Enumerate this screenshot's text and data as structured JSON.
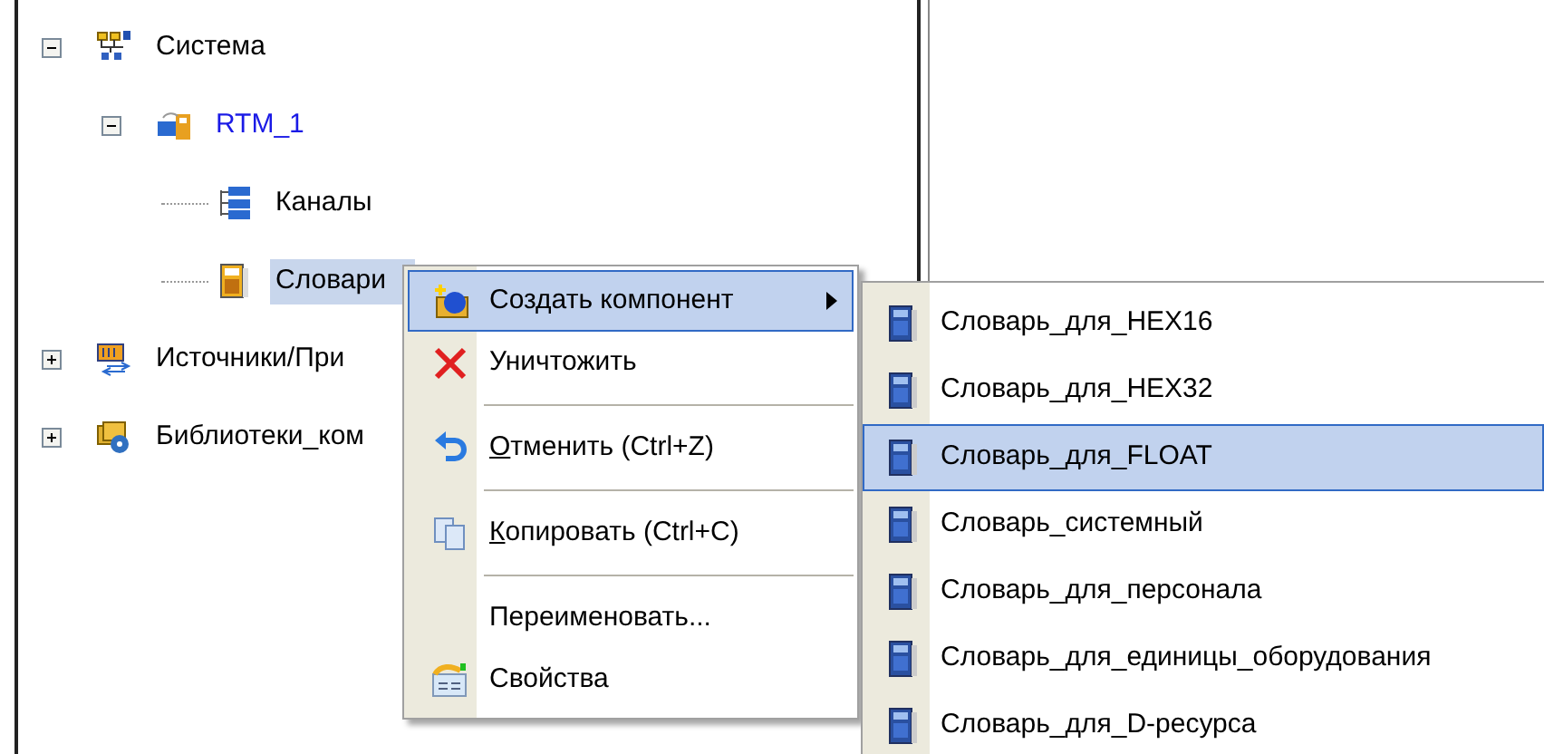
{
  "tree": [
    {
      "label": "Система",
      "expanded": true,
      "selected": false,
      "link": false,
      "children": [
        {
          "label": "RTM_1",
          "expanded": true,
          "selected": false,
          "link": true,
          "children": [
            {
              "label": "Каналы",
              "selected": false,
              "link": false
            },
            {
              "label": "Словари",
              "selected": true,
              "link": false
            }
          ]
        }
      ]
    },
    {
      "label": "Источники/При",
      "expanded": false,
      "selected": false,
      "link": false
    },
    {
      "label": "Библиотеки_ком",
      "expanded": false,
      "selected": false,
      "link": false
    }
  ],
  "context_menu": {
    "items": [
      {
        "kind": "item",
        "label": "Создать компонент",
        "submenu": true,
        "selected": true,
        "mnemonic": false
      },
      {
        "kind": "item",
        "label": "Уничтожить",
        "submenu": false,
        "selected": false,
        "mnemonic": false
      },
      {
        "kind": "separator"
      },
      {
        "kind": "item",
        "label": "Отменить (Ctrl+Z)",
        "submenu": false,
        "selected": false,
        "mnemonic": true
      },
      {
        "kind": "separator"
      },
      {
        "kind": "item",
        "label": "Копировать (Ctrl+C)",
        "submenu": false,
        "selected": false,
        "mnemonic": true
      },
      {
        "kind": "separator"
      },
      {
        "kind": "item",
        "label": "Переименовать...",
        "submenu": false,
        "selected": false,
        "mnemonic": false
      },
      {
        "kind": "item",
        "label": "Свойства",
        "submenu": false,
        "selected": false,
        "mnemonic": false
      }
    ]
  },
  "submenu": {
    "items": [
      {
        "label": "Словарь_для_HEX16",
        "selected": false
      },
      {
        "label": "Словарь_для_HEX32",
        "selected": false
      },
      {
        "label": "Словарь_для_FLOAT",
        "selected": true
      },
      {
        "label": "Словарь_системный",
        "selected": false
      },
      {
        "label": "Словарь_для_персонала",
        "selected": false
      },
      {
        "label": "Словарь_для_единицы_оборудования",
        "selected": false
      },
      {
        "label": "Словарь_для_D-ресурса",
        "selected": false
      }
    ]
  }
}
